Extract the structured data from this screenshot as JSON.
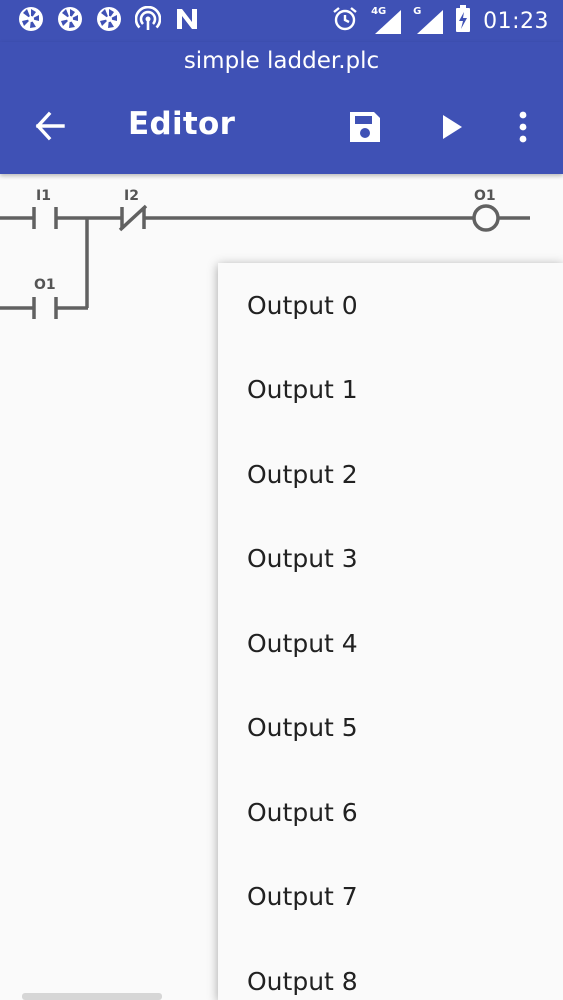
{
  "status_bar": {
    "time": "01:23",
    "network_4g": "4G",
    "network_g": "G",
    "notification_icons": [
      "shutter-icon",
      "shutter-icon",
      "shutter-icon",
      "hotspot-icon",
      "nfc-icon"
    ],
    "status_icons": [
      "alarm-icon",
      "signal-icon",
      "signal-icon",
      "battery-charging-icon"
    ]
  },
  "app_bar": {
    "document_title": "simple ladder.plc",
    "screen_title": "Editor",
    "actions": [
      "back-arrow-icon",
      "save-icon",
      "play-icon",
      "more-vert-icon"
    ]
  },
  "ladder": {
    "contacts": [
      {
        "label": "I1",
        "type": "normally-open"
      },
      {
        "label": "I2",
        "type": "normally-closed"
      },
      {
        "label": "O1",
        "type": "normally-open"
      }
    ],
    "coil": {
      "label": "O1"
    }
  },
  "output_menu": {
    "items": [
      "Output 0",
      "Output 1",
      "Output 2",
      "Output 3",
      "Output 4",
      "Output 5",
      "Output 6",
      "Output 7",
      "Output 8"
    ]
  },
  "colors": {
    "primary": "#3f51b5",
    "background": "#fafafa",
    "ladder_line": "#616161",
    "menu_text": "#212121"
  }
}
